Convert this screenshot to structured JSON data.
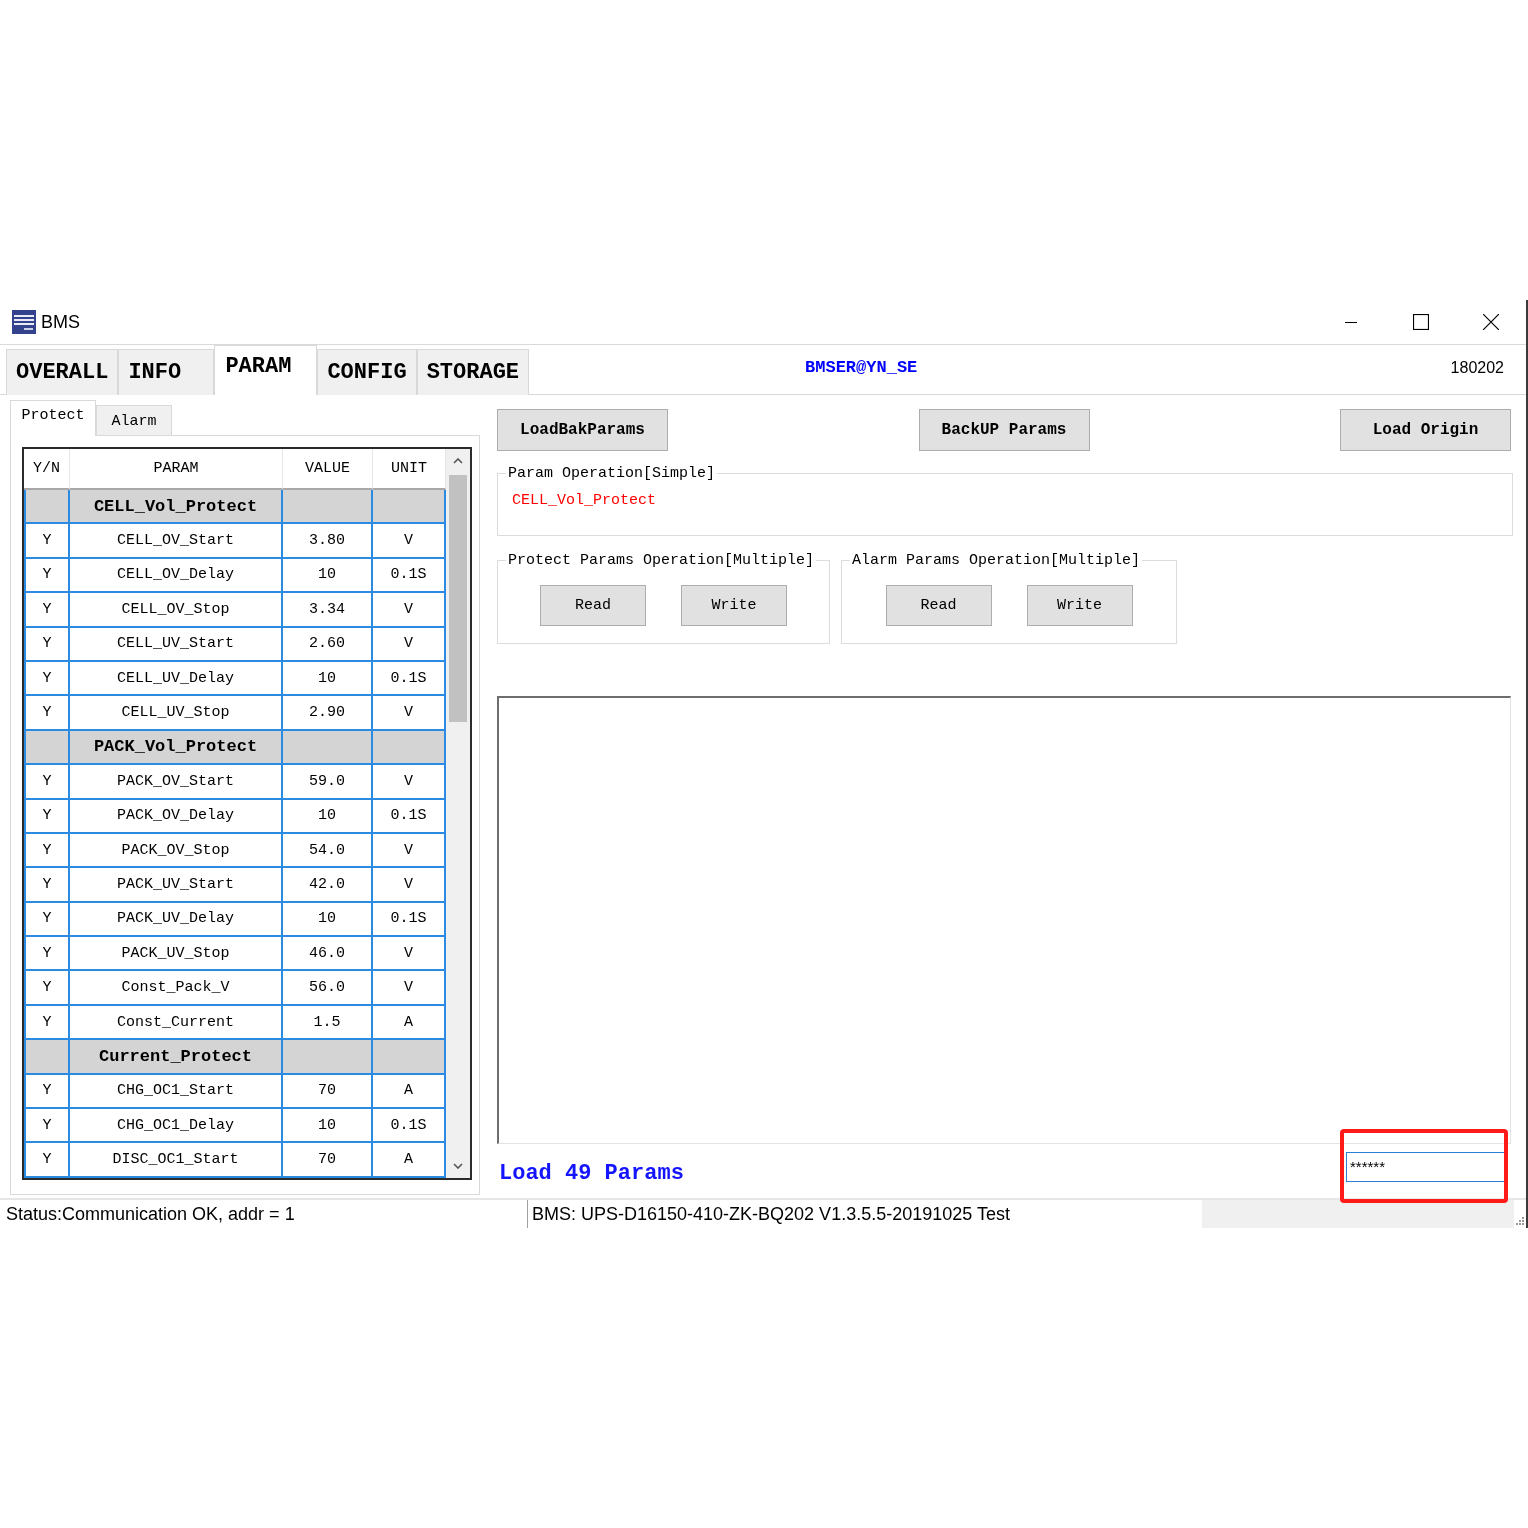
{
  "window": {
    "title": "BMS"
  },
  "tabs": [
    {
      "label": "OVERALL",
      "selected": false
    },
    {
      "label": "INFO",
      "selected": false
    },
    {
      "label": "PARAM",
      "selected": true
    },
    {
      "label": "CONFIG",
      "selected": false
    },
    {
      "label": "STORAGE",
      "selected": false
    }
  ],
  "header": {
    "center_text": "BMSER@YN_SE",
    "right_text": "180202"
  },
  "sub_tabs": [
    {
      "label": "Protect",
      "selected": true
    },
    {
      "label": "Alarm",
      "selected": false
    }
  ],
  "table": {
    "columns": [
      "Y/N",
      "PARAM",
      "VALUE",
      "UNIT"
    ],
    "rows": [
      {
        "kind": "group",
        "param": "CELL_Vol_Protect"
      },
      {
        "kind": "param",
        "yn": "Y",
        "param": "CELL_OV_Start",
        "value": "3.80",
        "unit": "V"
      },
      {
        "kind": "param",
        "yn": "Y",
        "param": "CELL_OV_Delay",
        "value": "10",
        "unit": "0.1S"
      },
      {
        "kind": "param",
        "yn": "Y",
        "param": "CELL_OV_Stop",
        "value": "3.34",
        "unit": "V"
      },
      {
        "kind": "param",
        "yn": "Y",
        "param": "CELL_UV_Start",
        "value": "2.60",
        "unit": "V"
      },
      {
        "kind": "param",
        "yn": "Y",
        "param": "CELL_UV_Delay",
        "value": "10",
        "unit": "0.1S"
      },
      {
        "kind": "param",
        "yn": "Y",
        "param": "CELL_UV_Stop",
        "value": "2.90",
        "unit": "V"
      },
      {
        "kind": "group",
        "param": "PACK_Vol_Protect"
      },
      {
        "kind": "param",
        "yn": "Y",
        "param": "PACK_OV_Start",
        "value": "59.0",
        "unit": "V"
      },
      {
        "kind": "param",
        "yn": "Y",
        "param": "PACK_OV_Delay",
        "value": "10",
        "unit": "0.1S"
      },
      {
        "kind": "param",
        "yn": "Y",
        "param": "PACK_OV_Stop",
        "value": "54.0",
        "unit": "V"
      },
      {
        "kind": "param",
        "yn": "Y",
        "param": "PACK_UV_Start",
        "value": "42.0",
        "unit": "V"
      },
      {
        "kind": "param",
        "yn": "Y",
        "param": "PACK_UV_Delay",
        "value": "10",
        "unit": "0.1S"
      },
      {
        "kind": "param",
        "yn": "Y",
        "param": "PACK_UV_Stop",
        "value": "46.0",
        "unit": "V"
      },
      {
        "kind": "param",
        "yn": "Y",
        "param": "Const_Pack_V",
        "value": "56.0",
        "unit": "V"
      },
      {
        "kind": "param",
        "yn": "Y",
        "param": "Const_Current",
        "value": "1.5",
        "unit": "A"
      },
      {
        "kind": "group",
        "param": "Current_Protect"
      },
      {
        "kind": "param",
        "yn": "Y",
        "param": "CHG_OC1_Start",
        "value": "70",
        "unit": "A"
      },
      {
        "kind": "param",
        "yn": "Y",
        "param": "CHG_OC1_Delay",
        "value": "10",
        "unit": "0.1S"
      },
      {
        "kind": "param",
        "yn": "Y",
        "param": "DISC_OC1_Start",
        "value": "70",
        "unit": "A"
      }
    ]
  },
  "action_buttons": [
    "LoadBakParams",
    "BackUP Params",
    "Load Origin"
  ],
  "simple_operation": {
    "title": "Param Operation[Simple]",
    "current_param": "CELL_Vol_Protect"
  },
  "multiple_operations": [
    {
      "title": "Protect Params Operation[Multiple]",
      "buttons": [
        "Read",
        "Write"
      ]
    },
    {
      "title": "Alarm Params Operation[Multiple]",
      "buttons": [
        "Read",
        "Write"
      ]
    }
  ],
  "load_message": "Load 49 Params",
  "password_field": {
    "value": "******",
    "highlighted": true
  },
  "status_bar": [
    "Status:Communication OK, addr = 1",
    "BMS: UPS-D16150-410-ZK-BQ202 V1.3.5.5-20191025 Test"
  ]
}
